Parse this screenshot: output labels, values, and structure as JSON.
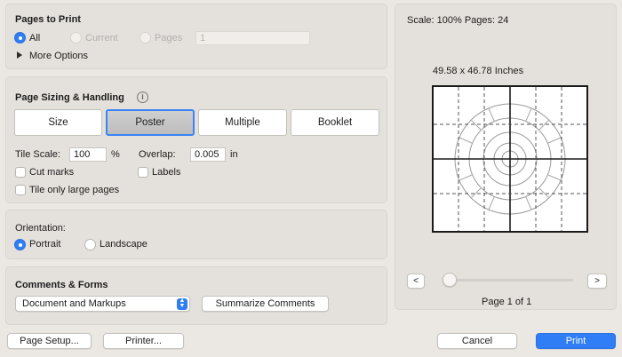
{
  "pages_to_print": {
    "title": "Pages to Print",
    "all_label": "All",
    "current_label": "Current",
    "pages_label": "Pages",
    "pages_value": "1",
    "more_options_label": "More Options"
  },
  "sizing": {
    "title": "Page Sizing & Handling",
    "info_glyph": "i",
    "modes": [
      "Size",
      "Poster",
      "Multiple",
      "Booklet"
    ],
    "selected_mode": "Poster",
    "tile_scale_label": "Tile Scale:",
    "tile_scale_value": "100",
    "tile_scale_unit": "%",
    "overlap_label": "Overlap:",
    "overlap_value": "0.005",
    "overlap_unit": "in",
    "cut_marks_label": "Cut marks",
    "labels_label": "Labels",
    "tile_large_label": "Tile only large pages"
  },
  "orientation": {
    "title": "Orientation:",
    "portrait_label": "Portrait",
    "landscape_label": "Landscape",
    "selected": "Portrait"
  },
  "comments": {
    "title": "Comments & Forms",
    "select_value": "Document and Markups",
    "summarize_label": "Summarize Comments"
  },
  "preview": {
    "scale_text": "Scale: 100% Pages: 24",
    "dimensions_text": "49.58 x 46.78 Inches",
    "prev_glyph": "<",
    "next_glyph": ">",
    "page_indicator": "Page 1 of 1"
  },
  "footer": {
    "page_setup_label": "Page Setup...",
    "printer_label": "Printer...",
    "cancel_label": "Cancel",
    "print_label": "Print"
  },
  "colors": {
    "accent": "#2f7ef6",
    "background": "#ebe7e3",
    "group_background": "#e4e0dc"
  }
}
